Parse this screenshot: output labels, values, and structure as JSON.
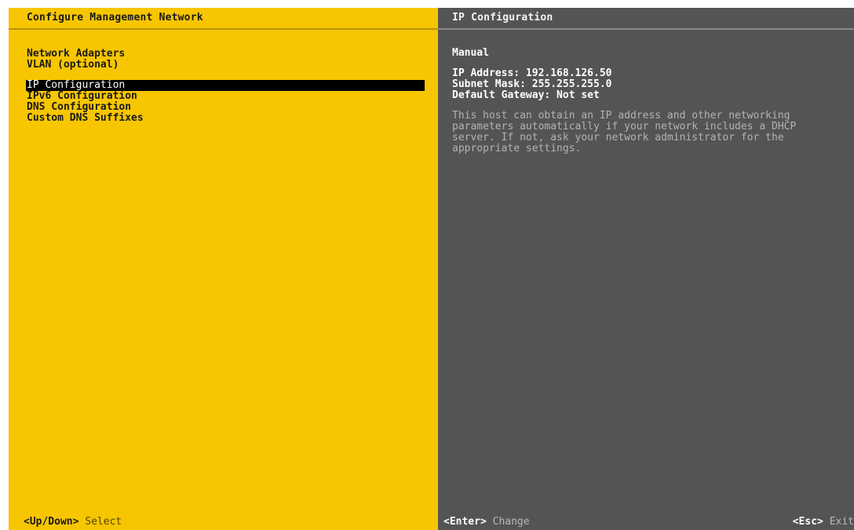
{
  "left_panel": {
    "title": "Configure Management Network",
    "menu": [
      {
        "label": "Network Adapters"
      },
      {
        "label": "VLAN (optional)"
      },
      {
        "label": "IP Configuration"
      },
      {
        "label": "IPv6 Configuration"
      },
      {
        "label": "DNS Configuration"
      },
      {
        "label": "Custom DNS Suffixes"
      }
    ],
    "selected_item": "IP Configuration",
    "footer": {
      "key": "<Up/Down>",
      "action": "Select"
    }
  },
  "right_panel": {
    "title": "IP Configuration",
    "mode": "Manual",
    "ip_address": "IP Address: 192.168.126.50",
    "subnet_mask": "Subnet Mask: 255.255.255.0",
    "default_gateway": "Default Gateway: Not set",
    "description": [
      "This host can obtain an IP address and other networking",
      "parameters automatically if your network includes a DHCP",
      "server. If not, ask your network administrator for the",
      "appropriate settings."
    ],
    "footer_left": {
      "key": "<Enter>",
      "action": "Change"
    },
    "footer_right": {
      "key": "<Esc>",
      "action": "Exit"
    }
  },
  "colors": {
    "left_background": "#f7c600",
    "right_background": "#545454",
    "selection_background": "#000000"
  }
}
